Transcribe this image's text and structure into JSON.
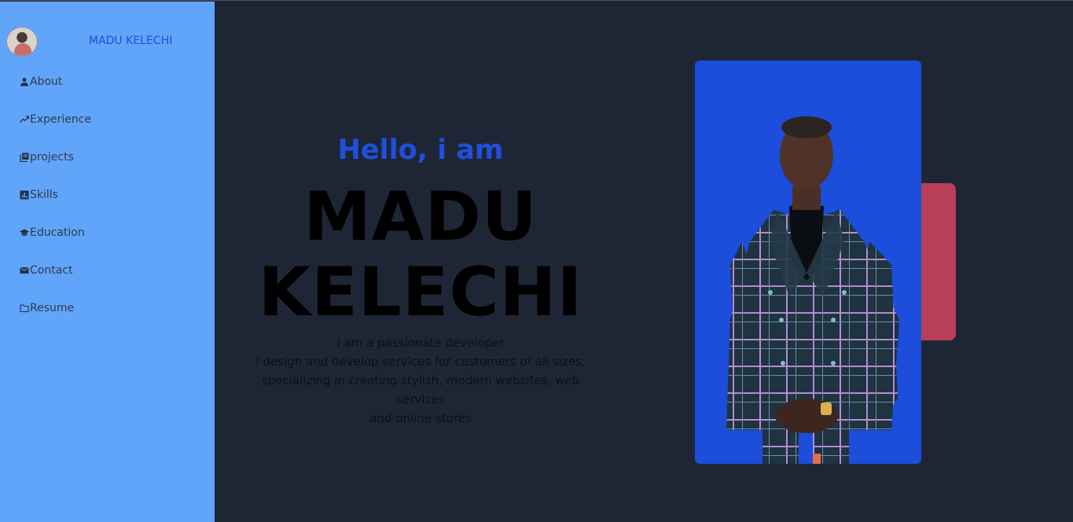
{
  "brand": {
    "name": "MADU KELECHI",
    "avatar_icon": "profile-avatar"
  },
  "nav": {
    "items": [
      {
        "label": "About",
        "icon": "person-icon"
      },
      {
        "label": "Experience",
        "icon": "trending-up-icon"
      },
      {
        "label": "projects",
        "icon": "library-books-icon"
      },
      {
        "label": "Skills",
        "icon": "bar-chart-icon"
      },
      {
        "label": "Education",
        "icon": "graduation-cap-icon"
      },
      {
        "label": "Contact",
        "icon": "envelope-icon"
      },
      {
        "label": "Resume",
        "icon": "folder-icon"
      }
    ]
  },
  "hero": {
    "greeting": "Hello, i am",
    "name_line1": "MADU",
    "name_line2": "KELECHI",
    "intro_line1": "I am a passionate developer",
    "intro_line2": "I design and develop services for customers of all sizes,",
    "intro_line3": "specializing in creating stylish, modern websites, web services",
    "intro_line4": "and online stores"
  },
  "colors": {
    "sidebar_bg": "#61a5fa",
    "page_bg": "#1e2636",
    "accent_blue": "#1f4fdb",
    "photo_bg": "#1c4ddb",
    "accent_pink": "#b83f57"
  }
}
